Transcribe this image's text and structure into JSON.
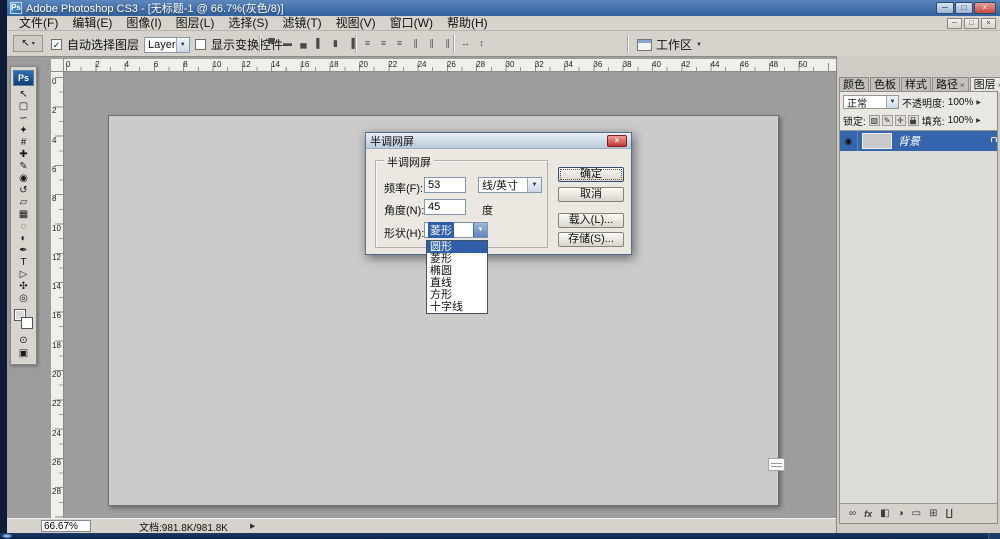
{
  "colors": {
    "titlebar-blue": "#3f6fae",
    "highlight-blue": "#3566ad",
    "list-selection-blue": "#2f5fa8",
    "taskbar-navy": "#0f2850",
    "pasteboard-gray": "#9d9d9d",
    "canvas-gray": "#cbcbcb",
    "chrome-gray": "#d6d3cc",
    "close-red": "#c5483e"
  },
  "glyphs": {
    "combo_arrow": "▼",
    "spinner": "▶",
    "check": "✓",
    "close": "×",
    "eye": "◉",
    "tool_arrow": "▾"
  },
  "titlebar": {
    "app_icon": "Ps",
    "title": "Adobe Photoshop CS3 - [无标题-1 @ 66.7%(灰色/8)]",
    "controls": [
      {
        "id": "minimize-button",
        "glyph": "─"
      },
      {
        "id": "maximize-button",
        "glyph": "□"
      },
      {
        "id": "close-button",
        "glyph": "×"
      }
    ]
  },
  "menubar": {
    "items": [
      {
        "id": "file",
        "label": "文件(F)"
      },
      {
        "id": "edit",
        "label": "编辑(E)"
      },
      {
        "id": "image",
        "label": "图像(I)"
      },
      {
        "id": "layer",
        "label": "图层(L)"
      },
      {
        "id": "select",
        "label": "选择(S)"
      },
      {
        "id": "filter",
        "label": "滤镜(T)"
      },
      {
        "id": "view",
        "label": "视图(V)"
      },
      {
        "id": "window",
        "label": "窗口(W)"
      },
      {
        "id": "help",
        "label": "帮助(H)"
      }
    ],
    "doc_controls": [
      {
        "id": "doc-minimize-button",
        "glyph": "─"
      },
      {
        "id": "doc-restore-button",
        "glyph": "□"
      },
      {
        "id": "doc-close-button",
        "glyph": "×"
      }
    ]
  },
  "optionsbar": {
    "tool_glyph": "↖",
    "auto_select_label": "自动选择图层",
    "auto_select_checked": true,
    "layer_dropdown_value": "Layer",
    "show_transform_label": "显示变换控件",
    "show_transform_checked": false,
    "align_icons": [
      {
        "id": "align-top-edges-icon",
        "glyph": "▀"
      },
      {
        "id": "align-vertical-centers-icon",
        "glyph": "▬"
      },
      {
        "id": "align-bottom-edges-icon",
        "glyph": "▄"
      },
      {
        "id": "align-left-edges-icon",
        "glyph": "▌"
      },
      {
        "id": "align-horizontal-centers-icon",
        "glyph": "▮"
      },
      {
        "id": "align-right-edges-icon",
        "glyph": "▐"
      }
    ],
    "distribute_icons": [
      {
        "id": "distribute-top-edges-icon",
        "glyph": "≡"
      },
      {
        "id": "distribute-vertical-centers-icon",
        "glyph": "≡"
      },
      {
        "id": "distribute-bottom-edges-icon",
        "glyph": "≡"
      },
      {
        "id": "distribute-left-edges-icon",
        "glyph": "∥"
      },
      {
        "id": "distribute-horizontal-centers-icon",
        "glyph": "∥"
      },
      {
        "id": "distribute-right-edges-icon",
        "glyph": "∥"
      }
    ],
    "space_icons": [
      {
        "id": "distribute-horizontal-space-icon",
        "glyph": "↔"
      },
      {
        "id": "distribute-vertical-space-icon",
        "glyph": "↕"
      }
    ],
    "workspace_label": "工作区"
  },
  "toolbar": {
    "logo": "Ps",
    "tools": [
      {
        "id": "move-tool",
        "glyph": "↖"
      },
      {
        "id": "rectangular-marquee-tool",
        "glyph": "▢"
      },
      {
        "id": "lasso-tool",
        "glyph": "∽"
      },
      {
        "id": "magic-wand-tool",
        "glyph": "✦"
      },
      {
        "id": "crop-tool",
        "glyph": "#"
      },
      {
        "id": "healing-brush-tool",
        "glyph": "✚"
      },
      {
        "id": "brush-tool",
        "glyph": "✎"
      },
      {
        "id": "clone-stamp-tool",
        "glyph": "◉"
      },
      {
        "id": "history-brush-tool",
        "glyph": "↺"
      },
      {
        "id": "eraser-tool",
        "glyph": "▱"
      },
      {
        "id": "gradient-tool",
        "glyph": "▦"
      },
      {
        "id": "blur-tool",
        "glyph": "◌"
      },
      {
        "id": "dodge-tool",
        "glyph": "◐"
      },
      {
        "id": "pen-tool",
        "glyph": "✒"
      },
      {
        "id": "type-tool",
        "glyph": "T"
      },
      {
        "id": "path-selection-tool",
        "glyph": "▷"
      },
      {
        "id": "hand-tool",
        "glyph": "✣"
      },
      {
        "id": "zoom-tool",
        "glyph": "◎"
      }
    ],
    "extras": [
      {
        "id": "quick-mask-button",
        "glyph": "⊙"
      },
      {
        "id": "screen-mode-button",
        "glyph": "▣"
      }
    ]
  },
  "rulers": {
    "horizontal": [
      "0",
      "2",
      "4",
      "6",
      "8",
      "10",
      "12",
      "14",
      "16",
      "18",
      "20",
      "22",
      "24",
      "26",
      "28",
      "30",
      "32",
      "34",
      "36",
      "38",
      "40",
      "42",
      "44",
      "46",
      "48",
      "50"
    ],
    "vertical": [
      "0",
      "2",
      "4",
      "6",
      "8",
      "10",
      "12",
      "14",
      "16",
      "18",
      "20",
      "22",
      "24",
      "26",
      "28"
    ]
  },
  "dialog": {
    "title": "半调网屏",
    "group_label": "半调网屏",
    "frequency_label": "频率(F):",
    "frequency_value": "53",
    "frequency_unit": "线/英寸",
    "angle_label": "角度(N):",
    "angle_value": "45",
    "angle_unit": "度",
    "shape_label": "形状(H):",
    "shape_value": "菱形",
    "shape_options": [
      "圆形",
      "菱形",
      "椭圆",
      "直线",
      "方形",
      "十字线"
    ],
    "highlighted_option": "圆形",
    "ok": "确定",
    "cancel": "取消",
    "load": "载入(L)...",
    "save": "存储(S)..."
  },
  "panels": {
    "tabs": [
      {
        "id": "color",
        "label": "颜色"
      },
      {
        "id": "swatches",
        "label": "色板"
      },
      {
        "id": "styles",
        "label": "样式"
      },
      {
        "id": "paths",
        "label": "路径",
        "closable": true
      },
      {
        "id": "layers",
        "label": "图层",
        "closable": true,
        "active": true
      }
    ],
    "blend_mode": "正常",
    "opacity_label": "不透明度:",
    "opacity_value": "100%",
    "lock_label": "锁定:",
    "lock_icons": [
      {
        "id": "lock-transparency-icon",
        "glyph": "▨"
      },
      {
        "id": "lock-pixels-icon",
        "glyph": "✎"
      },
      {
        "id": "lock-position-icon",
        "glyph": "✛"
      },
      {
        "id": "lock-all-icon",
        "glyph": "LOCK"
      }
    ],
    "fill_label": "填充:",
    "fill_value": "100%",
    "layer": {
      "name": "背景",
      "visible": true,
      "locked": true
    },
    "footer_icons": [
      {
        "id": "link-layers-icon",
        "glyph": "∞"
      },
      {
        "id": "layer-style-icon",
        "glyph": "fx"
      },
      {
        "id": "add-layer-mask-icon",
        "glyph": "◧"
      },
      {
        "id": "adjustment-layer-icon",
        "glyph": "◑"
      },
      {
        "id": "layer-group-icon",
        "glyph": "▭"
      },
      {
        "id": "new-layer-icon",
        "glyph": "⊞"
      },
      {
        "id": "delete-layer-icon",
        "glyph": "∐"
      }
    ]
  },
  "statusbar": {
    "zoom_value": "66.67%",
    "doc_info": "文档:981.8K/981.8K"
  }
}
